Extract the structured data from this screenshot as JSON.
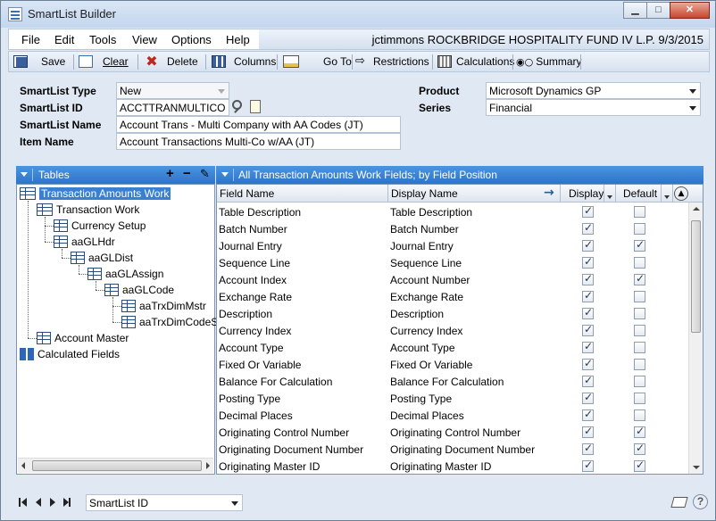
{
  "window": {
    "title": "SmartList Builder"
  },
  "menu": [
    "File",
    "Edit",
    "Tools",
    "View",
    "Options",
    "Help"
  ],
  "user_info": "jctimmons  ROCKBRIDGE HOSPITALITY FUND IV L.P.  9/3/2015",
  "toolbar": {
    "save": "Save",
    "clear": "Clear",
    "delete": "Delete",
    "columns": "Columns",
    "goto": "Go To",
    "restrictions": "Restrictions",
    "calculations": "Calculations",
    "summary": "Summary"
  },
  "form": {
    "smartlist_type_label": "SmartList Type",
    "smartlist_type_value": "New",
    "smartlist_id_label": "SmartList ID",
    "smartlist_id_value": "ACCTTRANMULTICO",
    "smartlist_name_label": "SmartList Name",
    "smartlist_name_value": "Account Trans - Multi Company with AA Codes (JT)",
    "item_name_label": "Item Name",
    "item_name_value": "Account Transactions Multi-Co w/AA (JT)",
    "product_label": "Product",
    "product_value": "Microsoft Dynamics GP",
    "series_label": "Series",
    "series_value": "Financial"
  },
  "tables_panel": {
    "title": "Tables",
    "nodes": [
      "Transaction Amounts Work",
      "Transaction Work",
      "Currency Setup",
      "aaGLHdr",
      "aaGLDist",
      "aaGLAssign",
      "aaGLCode",
      "aaTrxDimMstr",
      "aaTrxDimCodeS",
      "Account Master",
      "Calculated Fields"
    ]
  },
  "fields_panel": {
    "title": "All Transaction Amounts Work Fields; by Field Position",
    "col_field_name": "Field Name",
    "col_display_name": "Display Name",
    "col_display": "Display",
    "col_default": "Default",
    "rows": [
      {
        "field": "Table Description",
        "display_name": "Table Description",
        "display": true,
        "default": false
      },
      {
        "field": "Batch Number",
        "display_name": "Batch Number",
        "display": true,
        "default": false
      },
      {
        "field": "Journal Entry",
        "display_name": "Journal Entry",
        "display": true,
        "default": true
      },
      {
        "field": "Sequence Line",
        "display_name": "Sequence Line",
        "display": true,
        "default": false
      },
      {
        "field": "Account Index",
        "display_name": "Account Number",
        "display": true,
        "default": true
      },
      {
        "field": "Exchange Rate",
        "display_name": "Exchange Rate",
        "display": true,
        "default": false
      },
      {
        "field": "Description",
        "display_name": "Description",
        "display": true,
        "default": false
      },
      {
        "field": "Currency Index",
        "display_name": "Currency Index",
        "display": true,
        "default": false
      },
      {
        "field": "Account Type",
        "display_name": "Account Type",
        "display": true,
        "default": false
      },
      {
        "field": "Fixed Or Variable",
        "display_name": "Fixed Or Variable",
        "display": true,
        "default": false
      },
      {
        "field": "Balance For Calculation",
        "display_name": "Balance For Calculation",
        "display": true,
        "default": false
      },
      {
        "field": "Posting Type",
        "display_name": "Posting Type",
        "display": true,
        "default": false
      },
      {
        "field": "Decimal Places",
        "display_name": "Decimal Places",
        "display": true,
        "default": false
      },
      {
        "field": "Originating Control Number",
        "display_name": "Originating Control Number",
        "display": true,
        "default": true
      },
      {
        "field": "Originating Document Number",
        "display_name": "Originating Document Number",
        "display": true,
        "default": true
      },
      {
        "field": "Originating Master ID",
        "display_name": "Originating Master ID",
        "display": true,
        "default": true
      }
    ]
  },
  "statusbar": {
    "sort_value": "SmartList ID"
  }
}
